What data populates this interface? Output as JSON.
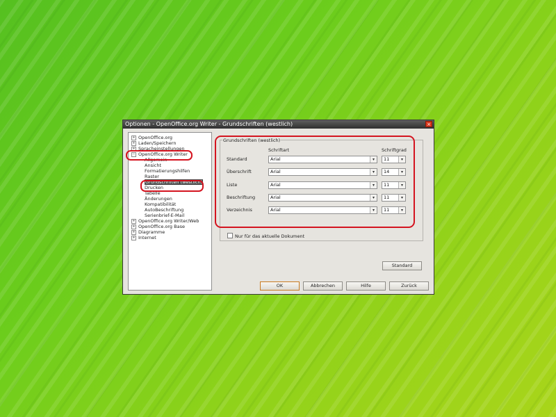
{
  "window": {
    "title": "Optionen - OpenOffice.org Writer - Grundschriften (westlich)",
    "close_glyph": "×"
  },
  "tree": {
    "items": [
      {
        "label": "OpenOffice.org",
        "expander": "+"
      },
      {
        "label": "Laden/Speichern",
        "expander": "+"
      },
      {
        "label": "Spracheinstellungen",
        "expander": "+"
      },
      {
        "label": "OpenOffice.org Writer",
        "expander": "−"
      },
      {
        "label": "Allgemein"
      },
      {
        "label": "Ansicht"
      },
      {
        "label": "Formatierungshilfen"
      },
      {
        "label": "Raster"
      },
      {
        "label": "Grundschriften (westlich)",
        "selected": true
      },
      {
        "label": "Drucken"
      },
      {
        "label": "Tabelle"
      },
      {
        "label": "Änderungen"
      },
      {
        "label": "Kompatibilität"
      },
      {
        "label": "AutoBeschriftung"
      },
      {
        "label": "Serienbrief-E-Mail"
      },
      {
        "label": "OpenOffice.org Writer/Web",
        "expander": "+"
      },
      {
        "label": "OpenOffice.org Base",
        "expander": "+"
      },
      {
        "label": "Diagramme",
        "expander": "+"
      },
      {
        "label": "Internet",
        "expander": "+"
      }
    ]
  },
  "group": {
    "title": "Grundschriften (westlich)",
    "col_font": "Schriftart",
    "col_size": "Schriftgrad",
    "rows": [
      {
        "label": "Standard",
        "font": "Arial",
        "size": "11"
      },
      {
        "label": "Überschrift",
        "font": "Arial",
        "size": "14"
      },
      {
        "label": "Liste",
        "font": "Arial",
        "size": "11"
      },
      {
        "label": "Beschriftung",
        "font": "Arial",
        "size": "11"
      },
      {
        "label": "Verzeichnis",
        "font": "Arial",
        "size": "11"
      }
    ],
    "only_current_doc": "Nur für das aktuelle Dokument",
    "dropdown_arrow": "▾"
  },
  "buttons": {
    "standard": "Standard",
    "ok": "OK",
    "cancel": "Abbrechen",
    "help": "Hilfe",
    "back": "Zurück"
  },
  "colors": {
    "highlight": "#d4131f",
    "background_green": "#6ccd1c"
  }
}
